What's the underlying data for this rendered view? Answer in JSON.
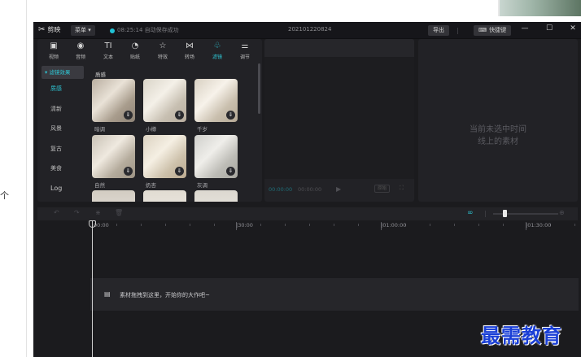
{
  "page": {
    "left_char": "个"
  },
  "titlebar": {
    "app_name": "剪映",
    "menu_label": "菜单",
    "save_status": "08:25:14 自动保存成功",
    "project_title": "202101220824",
    "export_label": "导出",
    "shortcut_label": "快捷键"
  },
  "media_toolbar": [
    {
      "label": "视频",
      "icon": "video-icon"
    },
    {
      "label": "音频",
      "icon": "audio-icon"
    },
    {
      "label": "文本",
      "icon": "text-icon"
    },
    {
      "label": "贴纸",
      "icon": "sticker-icon"
    },
    {
      "label": "特效",
      "icon": "effects-icon"
    },
    {
      "label": "转场",
      "icon": "transition-icon"
    },
    {
      "label": "滤镜",
      "icon": "filter-icon",
      "active": true
    },
    {
      "label": "调节",
      "icon": "adjust-icon"
    }
  ],
  "filter_categories": {
    "header": "▾ 滤镜效果",
    "items": [
      "质感",
      "清新",
      "风景",
      "复古",
      "美食",
      "Log"
    ],
    "active": "质感"
  },
  "filter_grid": {
    "section_title": "质感",
    "items": [
      {
        "label": "暗调"
      },
      {
        "label": "小樽"
      },
      {
        "label": "千岁"
      },
      {
        "label": "自然"
      },
      {
        "label": "奶杏"
      },
      {
        "label": "灰调"
      }
    ]
  },
  "player": {
    "current_time": "00:00:00",
    "total_time": "00:00:00",
    "ratio_label": "原始"
  },
  "details": {
    "empty_line1": "当前未选中时间",
    "empty_line2": "线上的素材"
  },
  "timeline": {
    "ruler": [
      "00:00",
      "|30:00",
      "|01:00:00",
      "|01:30:00"
    ],
    "hint": "素材拖拽到这里，开始你的大作吧~"
  },
  "watermark": "最需教育",
  "colors": {
    "accent": "#2ec5d3",
    "bg": "#1b1b1e",
    "panel": "#222226",
    "watermark": "#1a3fd6"
  }
}
